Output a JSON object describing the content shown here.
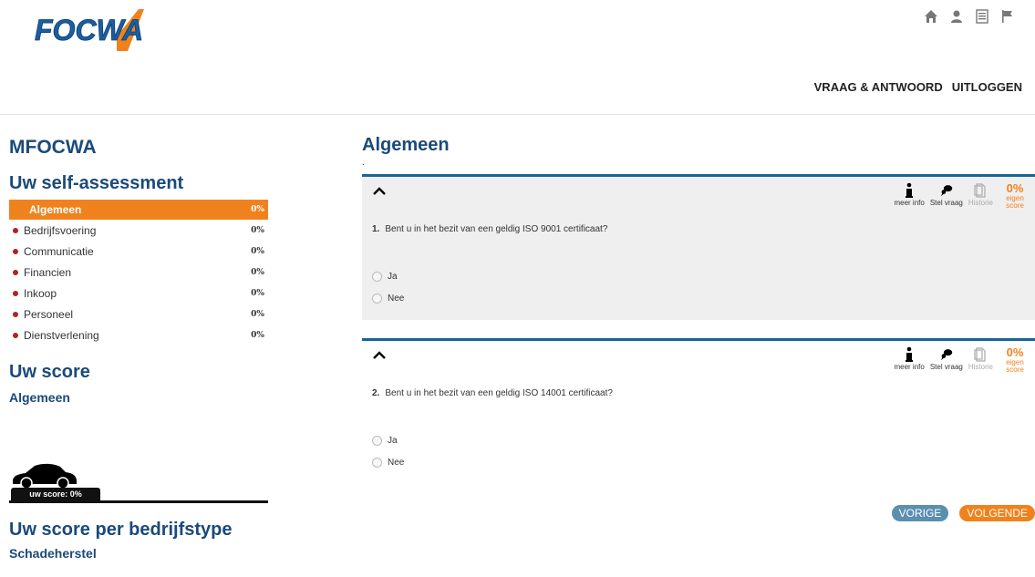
{
  "header": {
    "logo_text": "FOCWA",
    "nav": [
      "VRAAG & ANTWOORD",
      "UITLOGGEN"
    ],
    "icons": [
      "home-icon",
      "user-icon",
      "list-icon",
      "flag-icon"
    ]
  },
  "sidebar": {
    "title": "MFOCWA",
    "assessment_title": "Uw self-assessment",
    "categories": [
      {
        "label": "Algemeen",
        "pct": "0%"
      },
      {
        "label": "Bedrijfsvoering",
        "pct": "0%"
      },
      {
        "label": "Communicatie",
        "pct": "0%"
      },
      {
        "label": "Financien",
        "pct": "0%"
      },
      {
        "label": "Inkoop",
        "pct": "0%"
      },
      {
        "label": "Personeel",
        "pct": "0%"
      },
      {
        "label": "Dienstverlening",
        "pct": "0%"
      }
    ],
    "score_title": "Uw score",
    "score_sub": "Algemeen",
    "score_label": "uw score: 0%",
    "bedrijf_title": "Uw score per bedrijfstype",
    "bedrijf_sub": "Schadeherstel"
  },
  "main": {
    "title": "Algemeen",
    "dot": ".",
    "tools": {
      "info": "meer info",
      "ask": "Stel vraag",
      "history": "Historie",
      "score": "0%",
      "score_label": "eigen score"
    },
    "questions": [
      {
        "num": "1.",
        "text": "Bent u in het bezit van een geldig ISO 9001 certificaat?",
        "options": [
          "Ja",
          "Nee"
        ]
      },
      {
        "num": "2.",
        "text": "Bent u in het bezit van een geldig ISO 14001 certificaat?",
        "options": [
          "Ja",
          "Nee"
        ]
      }
    ],
    "prev": "VORIGE",
    "next": "VOLGENDE"
  },
  "colors": {
    "accent": "#f0821e",
    "brand_blue": "#1a4a7a",
    "rule_blue": "#1a6496"
  }
}
